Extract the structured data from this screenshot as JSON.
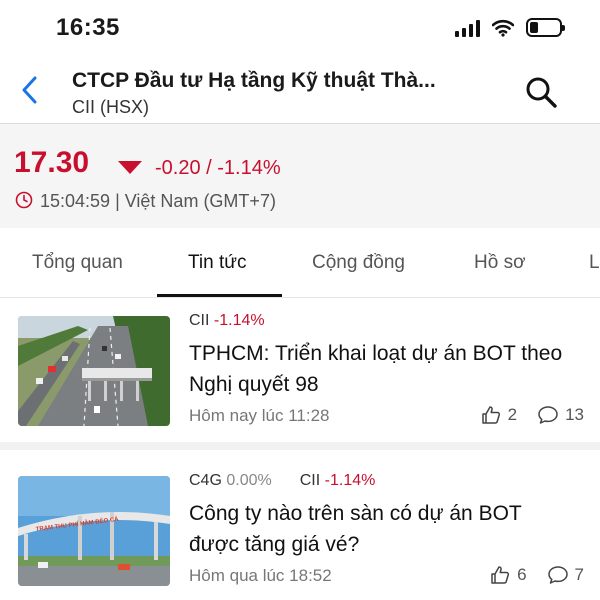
{
  "status_bar": {
    "time": "16:35",
    "battery_level": 0.3
  },
  "header": {
    "title": "CTCP Đầu tư Hạ tầng Kỹ thuật Thà...",
    "subtitle": "CII (HSX)"
  },
  "quote": {
    "price": "17.30",
    "change": "-0.20 / -1.14%",
    "timestamp": "15:04:59 | Việt Nam (GMT+7)",
    "direction": "down",
    "color_down": "#c8102e"
  },
  "tabs": [
    {
      "label": "Tổng quan",
      "active": false
    },
    {
      "label": "Tin tức",
      "active": true
    },
    {
      "label": "Cộng đồng",
      "active": false
    },
    {
      "label": "Hồ sơ",
      "active": false
    },
    {
      "label": "L",
      "active": false
    }
  ],
  "news": [
    {
      "tags": [
        {
          "code": "CII",
          "change": "-1.14%"
        }
      ],
      "title": "TPHCM: Triển khai loạt dự án BOT theo Nghị quyết 98",
      "time": "Hôm nay lúc 11:28",
      "likes": "2",
      "comments": "13"
    },
    {
      "tags": [
        {
          "code": "C4G",
          "change": "0.00%"
        },
        {
          "code": "CII",
          "change": "-1.14%"
        }
      ],
      "title": "Công ty nào trên sàn có dự án BOT được tăng giá vé?",
      "time": "Hôm qua lúc 18:52",
      "likes": "6",
      "comments": "7"
    }
  ],
  "thumb_sign_text": "TRẠM THU PHÍ HẦM ĐÈO CẢ"
}
